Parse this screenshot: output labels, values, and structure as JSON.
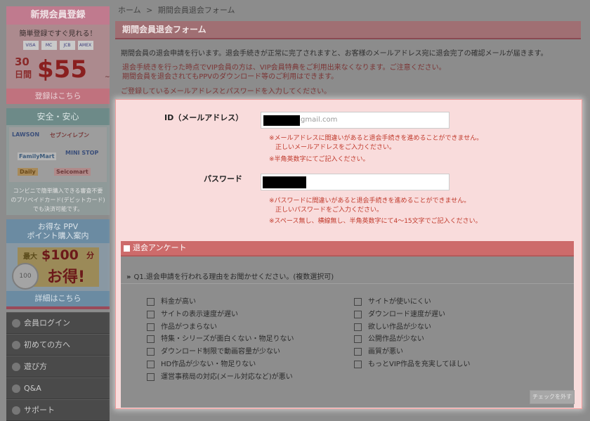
{
  "breadcrumb": {
    "home": "ホーム",
    "sep": ">",
    "current": "期間会員退会フォーム"
  },
  "sidebar": {
    "register": {
      "title": "新規会員登録",
      "subtitle": "簡単登録ですぐ見れる！",
      "cards": [
        "VISA",
        "MC",
        "JCB",
        "AMEX"
      ],
      "days": "30",
      "days_unit": "日間",
      "price": "$55",
      "tilde": "~",
      "cta": "登録はこちら"
    },
    "safety": {
      "title": "安全・安心",
      "stores": [
        "LAWSON",
        "セブンイレブン",
        "FamilyMart",
        "MINI STOP",
        "Daily",
        "Seicomart"
      ],
      "text1": "コンビニで簡単購入できる審査不要",
      "text2": "のプリペイドカード(デビットカード)",
      "text3": "でも決済可能です。"
    },
    "ppv": {
      "title1": "お得な PPV",
      "title2": "ポイント購入案内",
      "max": "最大",
      "amount": "$100",
      "suffix": "分",
      "otoku": "お得!",
      "coin": "100",
      "cta": "詳細はこちら"
    },
    "menu": [
      {
        "label": "会員ログイン"
      },
      {
        "label": "初めての方へ"
      },
      {
        "label": "遊び方"
      },
      {
        "label": "Q&A"
      },
      {
        "label": "サポート"
      }
    ]
  },
  "page": {
    "title": "期間会員退会フォーム",
    "intro": "期間会員の退会申請を行います。退会手続きが正常に完了されますと、お客様のメールアドレス宛に退会完了の確認メールが届きます。",
    "warn1": "退会手続きを行った時点でVIP会員の方は、VIP会員特典をご利用出来なくなります。ご注意ください。",
    "warn2": "期間会員を退会されてもPPVのダウンロード等のご利用はできます。",
    "warn3": "ご登録しているメールアドレスとパスワードを入力してください。"
  },
  "form": {
    "email_label": "ID（メールアドレス）",
    "email_value_visible": "gmail.com",
    "email_notes": [
      "※メールアドレスに間違いがあると退会手続きを進めることができません。",
      "　正しいメールアドレスをご入力ください。",
      "※半角英数字にてご記入ください。"
    ],
    "password_label": "パスワード",
    "password_notes": [
      "※パスワードに間違いがあると退会手続きを進めることができません。",
      "　正しいパスワードをご入力ください。",
      "※スペース無し、横線無し、半角英数字にて4～15文字でご記入ください。"
    ]
  },
  "survey": {
    "title": "退会アンケート",
    "question_marker": "»",
    "question": "Q1.退会申請を行われる理由をお聞かせください。(複数選択可)",
    "left_options": [
      "料金が高い",
      "サイトの表示速度が遅い",
      "作品がつまらない",
      "特集・シリーズが面白くない・物足りない",
      "ダウンロード制限で動画容量が少ない",
      "HD作品が少ない・物足りない",
      "運営事務局の対応(メール対応など)が悪い"
    ],
    "right_options": [
      "サイトが使いにくい",
      "ダウンロード速度が遅い",
      "欲しい作品が少ない",
      "公開作品が少ない",
      "画質が悪い",
      "もっとVIP作品を充実してほしい"
    ],
    "uncheck_label": "チェックを外す"
  }
}
